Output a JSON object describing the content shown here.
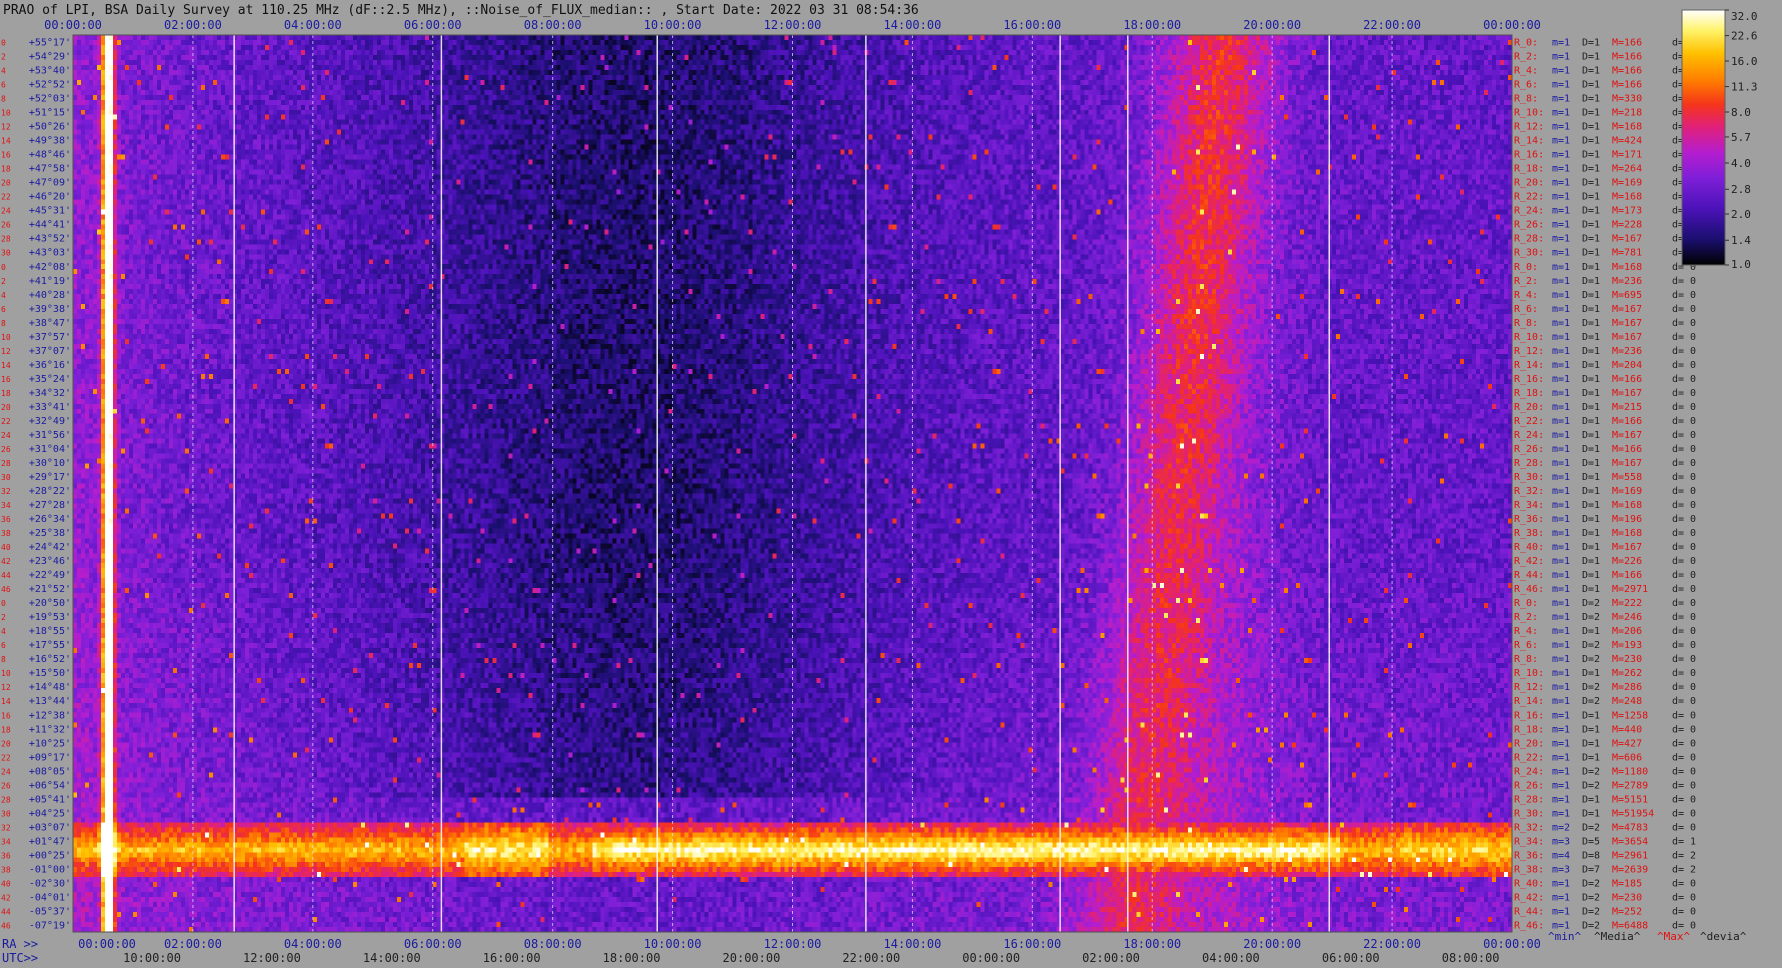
{
  "title": "PRAO of LPI, BSA Daily Survey at 110.25 MHz (dF::2.5 MHz), ::Noise_of_FLUX_median:: , Start Date: 2022 03 31 08:54:36",
  "chart_data": {
    "type": "heatmap",
    "title": "PRAO of LPI, BSA Daily Survey at 110.25 MHz (dF::2.5 MHz), ::Noise_of_FLUX_median:: , Start Date: 2022 03 31 08:54:36",
    "top_axis_ticks": [
      "00:00:00",
      "02:00:00",
      "04:00:00",
      "06:00:00",
      "08:00:00",
      "10:00:00",
      "12:00:00",
      "14:00:00",
      "16:00:00",
      "18:00:00",
      "20:00:00",
      "22:00:00",
      "00:00:00"
    ],
    "ra_axis_label": "RA >>",
    "ra_axis_ticks": [
      "00:00:00",
      "02:00:00",
      "04:00:00",
      "06:00:00",
      "08:00:00",
      "10:00:00",
      "12:00:00",
      "14:00:00",
      "16:00:00",
      "18:00:00",
      "20:00:00",
      "22:00:00",
      "00:00:00"
    ],
    "utc_axis_label": "UTC>>",
    "utc_axis_ticks": [
      "10:00:00",
      "12:00:00",
      "14:00:00",
      "16:00:00",
      "18:00:00",
      "20:00:00",
      "22:00:00",
      "00:00:00",
      "02:00:00",
      "04:00:00",
      "06:00:00",
      "08:00:00"
    ],
    "declinations": [
      "+55°17'",
      "+54°29'",
      "+53°40'",
      "+52°52'",
      "+52°03'",
      "+51°15'",
      "+50°26'",
      "+49°38'",
      "+48°46'",
      "+47°58'",
      "+47°09'",
      "+46°20'",
      "+45°31'",
      "+44°41'",
      "+43°52'",
      "+43°03'",
      "+42°08'",
      "+41°19'",
      "+40°28'",
      "+39°38'",
      "+38°47'",
      "+37°57'",
      "+37°07'",
      "+36°16'",
      "+35°24'",
      "+34°32'",
      "+33°41'",
      "+32°49'",
      "+31°56'",
      "+31°04'",
      "+30°10'",
      "+29°17'",
      "+28°22'",
      "+27°28'",
      "+26°34'",
      "+25°38'",
      "+24°42'",
      "+23°46'",
      "+22°49'",
      "+21°52'",
      "+20°50'",
      "+19°53'",
      "+18°55'",
      "+17°55'",
      "+16°52'",
      "+15°50'",
      "+14°48'",
      "+13°44'",
      "+12°38'",
      "+11°32'",
      "+10°25'",
      "+09°17'",
      "+08°05'",
      "+06°54'",
      "+05°41'",
      "+04°25'",
      "+03°07'",
      "+01°47'",
      "+00°25'",
      "-01°00'",
      "-02°30'",
      "-04°01'",
      "-05°37'",
      "-07°19'"
    ],
    "row_index_labels": [
      "0",
      "2",
      "4",
      "6",
      "8",
      "10",
      "12",
      "14",
      "16",
      "18",
      "20",
      "22",
      "24",
      "26",
      "28",
      "30",
      "0",
      "2",
      "4",
      "6",
      "8",
      "10",
      "12",
      "14",
      "16",
      "18",
      "20",
      "22",
      "24",
      "26",
      "28",
      "30",
      "32",
      "34",
      "36",
      "38",
      "40",
      "42",
      "44",
      "46",
      "0",
      "2",
      "4",
      "6",
      "8",
      "10",
      "12",
      "14",
      "16",
      "18",
      "20",
      "22",
      "24",
      "26",
      "28",
      "30",
      "32",
      "34",
      "36",
      "38",
      "40",
      "42",
      "44",
      "46"
    ],
    "stats": [
      {
        "r": "R_0:",
        "m": "m=1",
        "D": "D=1",
        "M": "M=166",
        "d": "d= 0"
      },
      {
        "r": "R_2:",
        "m": "m=1",
        "D": "D=1",
        "M": "M=166",
        "d": "d= 0"
      },
      {
        "r": "R_4:",
        "m": "m=1",
        "D": "D=1",
        "M": "M=166",
        "d": "d= 0"
      },
      {
        "r": "R_6:",
        "m": "m=1",
        "D": "D=1",
        "M": "M=166",
        "d": "d= 0"
      },
      {
        "r": "R_8:",
        "m": "m=1",
        "D": "D=1",
        "M": "M=330",
        "d": "d= 0"
      },
      {
        "r": "R_10:",
        "m": "m=1",
        "D": "D=1",
        "M": "M=218",
        "d": "d="
      },
      {
        "r": "R_12:",
        "m": "m=1",
        "D": "D=1",
        "M": "M=168",
        "d": "d="
      },
      {
        "r": "R_14:",
        "m": "m=1",
        "D": "D=1",
        "M": "M=424",
        "d": "d="
      },
      {
        "r": "R_16:",
        "m": "m=1",
        "D": "D=1",
        "M": "M=171",
        "d": "d="
      },
      {
        "r": "R_18:",
        "m": "m=1",
        "D": "D=1",
        "M": "M=264",
        "d": "d="
      },
      {
        "r": "R_20:",
        "m": "m=1",
        "D": "D=1",
        "M": "M=169",
        "d": "d="
      },
      {
        "r": "R_22:",
        "m": "m=1",
        "D": "D=1",
        "M": "M=168",
        "d": "d="
      },
      {
        "r": "R_24:",
        "m": "m=1",
        "D": "D=1",
        "M": "M=173",
        "d": "d="
      },
      {
        "r": "R_26:",
        "m": "m=1",
        "D": "D=1",
        "M": "M=228",
        "d": "d="
      },
      {
        "r": "R_28:",
        "m": "m=1",
        "D": "D=1",
        "M": "M=167",
        "d": "d="
      },
      {
        "r": "R_30:",
        "m": "m=1",
        "D": "D=1",
        "M": "M=781",
        "d": "d="
      },
      {
        "r": "R_0:",
        "m": "m=1",
        "D": "D=1",
        "M": "M=168",
        "d": "d= 0"
      },
      {
        "r": "R_2:",
        "m": "m=1",
        "D": "D=1",
        "M": "M=236",
        "d": "d= 0"
      },
      {
        "r": "R_4:",
        "m": "m=1",
        "D": "D=1",
        "M": "M=695",
        "d": "d= 0"
      },
      {
        "r": "R_6:",
        "m": "m=1",
        "D": "D=1",
        "M": "M=167",
        "d": "d= 0"
      },
      {
        "r": "R_8:",
        "m": "m=1",
        "D": "D=1",
        "M": "M=167",
        "d": "d= 0"
      },
      {
        "r": "R_10:",
        "m": "m=1",
        "D": "D=1",
        "M": "M=167",
        "d": "d= 0"
      },
      {
        "r": "R_12:",
        "m": "m=1",
        "D": "D=1",
        "M": "M=236",
        "d": "d= 0"
      },
      {
        "r": "R_14:",
        "m": "m=1",
        "D": "D=1",
        "M": "M=204",
        "d": "d= 0"
      },
      {
        "r": "R_16:",
        "m": "m=1",
        "D": "D=1",
        "M": "M=166",
        "d": "d= 0"
      },
      {
        "r": "R_18:",
        "m": "m=1",
        "D": "D=1",
        "M": "M=167",
        "d": "d= 0"
      },
      {
        "r": "R_20:",
        "m": "m=1",
        "D": "D=1",
        "M": "M=215",
        "d": "d= 0"
      },
      {
        "r": "R_22:",
        "m": "m=1",
        "D": "D=1",
        "M": "M=166",
        "d": "d= 0"
      },
      {
        "r": "R_24:",
        "m": "m=1",
        "D": "D=1",
        "M": "M=167",
        "d": "d= 0"
      },
      {
        "r": "R_26:",
        "m": "m=1",
        "D": "D=1",
        "M": "M=166",
        "d": "d= 0"
      },
      {
        "r": "R_28:",
        "m": "m=1",
        "D": "D=1",
        "M": "M=167",
        "d": "d= 0"
      },
      {
        "r": "R_30:",
        "m": "m=1",
        "D": "D=1",
        "M": "M=558",
        "d": "d= 0"
      },
      {
        "r": "R_32:",
        "m": "m=1",
        "D": "D=1",
        "M": "M=169",
        "d": "d= 0"
      },
      {
        "r": "R_34:",
        "m": "m=1",
        "D": "D=1",
        "M": "M=168",
        "d": "d= 0"
      },
      {
        "r": "R_36:",
        "m": "m=1",
        "D": "D=1",
        "M": "M=196",
        "d": "d= 0"
      },
      {
        "r": "R_38:",
        "m": "m=1",
        "D": "D=1",
        "M": "M=168",
        "d": "d= 0"
      },
      {
        "r": "R_40:",
        "m": "m=1",
        "D": "D=1",
        "M": "M=167",
        "d": "d= 0"
      },
      {
        "r": "R_42:",
        "m": "m=1",
        "D": "D=1",
        "M": "M=226",
        "d": "d= 0"
      },
      {
        "r": "R_44:",
        "m": "m=1",
        "D": "D=1",
        "M": "M=166",
        "d": "d= 0"
      },
      {
        "r": "R_46:",
        "m": "m=1",
        "D": "D=1",
        "M": "M=2971",
        "d": "d= 0"
      },
      {
        "r": "R_0:",
        "m": "m=1",
        "D": "D=2",
        "M": "M=222",
        "d": "d= 0"
      },
      {
        "r": "R_2:",
        "m": "m=1",
        "D": "D=2",
        "M": "M=246",
        "d": "d= 0"
      },
      {
        "r": "R_4:",
        "m": "m=1",
        "D": "D=1",
        "M": "M=206",
        "d": "d= 0"
      },
      {
        "r": "R_6:",
        "m": "m=1",
        "D": "D=2",
        "M": "M=193",
        "d": "d= 0"
      },
      {
        "r": "R_8:",
        "m": "m=1",
        "D": "D=2",
        "M": "M=230",
        "d": "d= 0"
      },
      {
        "r": "R_10:",
        "m": "m=1",
        "D": "D=1",
        "M": "M=262",
        "d": "d= 0"
      },
      {
        "r": "R_12:",
        "m": "m=1",
        "D": "D=2",
        "M": "M=286",
        "d": "d= 0"
      },
      {
        "r": "R_14:",
        "m": "m=1",
        "D": "D=2",
        "M": "M=248",
        "d": "d= 0"
      },
      {
        "r": "R_16:",
        "m": "m=1",
        "D": "D=1",
        "M": "M=1258",
        "d": "d= 0"
      },
      {
        "r": "R_18:",
        "m": "m=1",
        "D": "D=1",
        "M": "M=440",
        "d": "d= 0"
      },
      {
        "r": "R_20:",
        "m": "m=1",
        "D": "D=1",
        "M": "M=427",
        "d": "d= 0"
      },
      {
        "r": "R_22:",
        "m": "m=1",
        "D": "D=1",
        "M": "M=606",
        "d": "d= 0"
      },
      {
        "r": "R_24:",
        "m": "m=1",
        "D": "D=2",
        "M": "M=1180",
        "d": "d= 0"
      },
      {
        "r": "R_26:",
        "m": "m=1",
        "D": "D=2",
        "M": "M=2789",
        "d": "d= 0"
      },
      {
        "r": "R_28:",
        "m": "m=1",
        "D": "D=1",
        "M": "M=5151",
        "d": "d= 0"
      },
      {
        "r": "R_30:",
        "m": "m=1",
        "D": "D=1",
        "M": "M=51954",
        "d": "d= 0"
      },
      {
        "r": "R_32:",
        "m": "m=2",
        "D": "D=2",
        "M": "M=4783",
        "d": "d= 0"
      },
      {
        "r": "R_34:",
        "m": "m=3",
        "D": "D=5",
        "M": "M=3654",
        "d": "d= 1"
      },
      {
        "r": "R_36:",
        "m": "m=4",
        "D": "D=8",
        "M": "M=2961",
        "d": "d= 2"
      },
      {
        "r": "R_38:",
        "m": "m=3",
        "D": "D=7",
        "M": "M=2639",
        "d": "d= 2"
      },
      {
        "r": "R_40:",
        "m": "m=1",
        "D": "D=2",
        "M": "M=185",
        "d": "d= 0"
      },
      {
        "r": "R_42:",
        "m": "m=1",
        "D": "D=2",
        "M": "M=230",
        "d": "d= 0"
      },
      {
        "r": "R_44:",
        "m": "m=1",
        "D": "D=2",
        "M": "M=252",
        "d": "d= 0"
      },
      {
        "r": "R_46:",
        "m": "m=1",
        "D": "D=2",
        "M": "M=6488",
        "d": "d= 0"
      }
    ],
    "stats_legend": {
      "min": "^min^",
      "median": "^Media^",
      "max": "^Max^",
      "devia": "^devia^"
    },
    "colorbar": {
      "ticks": [
        "32.0",
        "22.6",
        "16.0",
        "11.3",
        "8.0",
        "5.7",
        "4.0",
        "2.8",
        "2.0",
        "1.4",
        "1.0"
      ],
      "range": [
        1.0,
        32.0
      ],
      "scale": "log"
    },
    "colors": {
      "background": "#a0a0a0",
      "label_blue": "#1a1aa0",
      "label_red": "#e01010",
      "label_dark": "#202020",
      "colormap": [
        "#000000",
        "#1a0f6e",
        "#4b12b8",
        "#7e1fd8",
        "#b41ecf",
        "#e0207a",
        "#f5351a",
        "#ff7b00",
        "#ffc000",
        "#fff36a",
        "#ffffff"
      ]
    },
    "features": {
      "bright_band_declinations": [
        "+01°47'",
        "-01°00'"
      ],
      "notes": "Noise-of-flux median map: RA (hours) vs declination, Milky Way band visible near declination 0 and around RA 19-21h, strong source near RA 01h."
    }
  }
}
